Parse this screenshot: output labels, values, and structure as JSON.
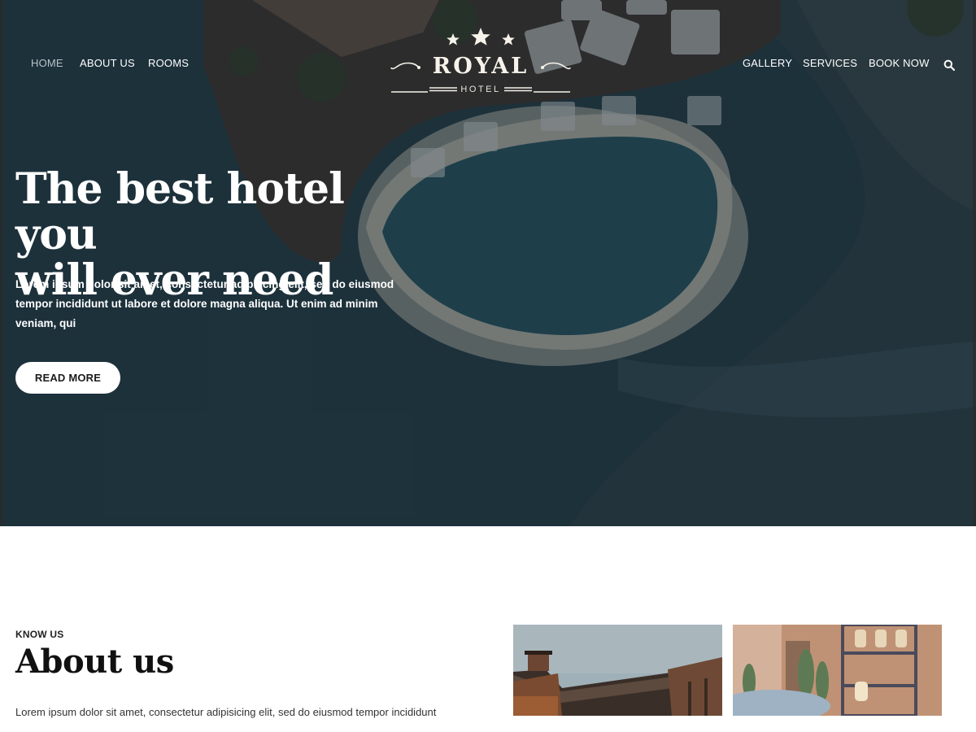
{
  "nav": {
    "left": [
      {
        "label": "HOME",
        "active": true
      },
      {
        "label": "ABOUT US",
        "active": false
      },
      {
        "label": "ROOMS",
        "active": false
      }
    ],
    "right": [
      {
        "label": "GALLERY"
      },
      {
        "label": "SERVICES"
      },
      {
        "label": "BOOK NOW"
      }
    ],
    "search_icon": "search-icon"
  },
  "logo": {
    "name": "ROYAL",
    "sub": "HOTEL",
    "icon": "three-stars-icon"
  },
  "hero": {
    "title_line1": "The best hotel you",
    "title_line2": "will ever need",
    "text": "Lorem ipsum dolor sit amet, consectetur adipiscing elit, sed do eiusmod tempor incididunt ut labore et dolore magna aliqua. Ut enim ad minim veniam, qui",
    "cta_label": "READ MORE"
  },
  "about": {
    "kicker": "KNOW US",
    "title": "About us",
    "text": "Lorem ipsum dolor sit amet, consectetur adipisicing elit, sed do eiusmod tempor incididunt"
  },
  "colors": {
    "hero_overlay": "#233a44",
    "button_bg": "#ffffff",
    "text_light": "#ffffff"
  }
}
